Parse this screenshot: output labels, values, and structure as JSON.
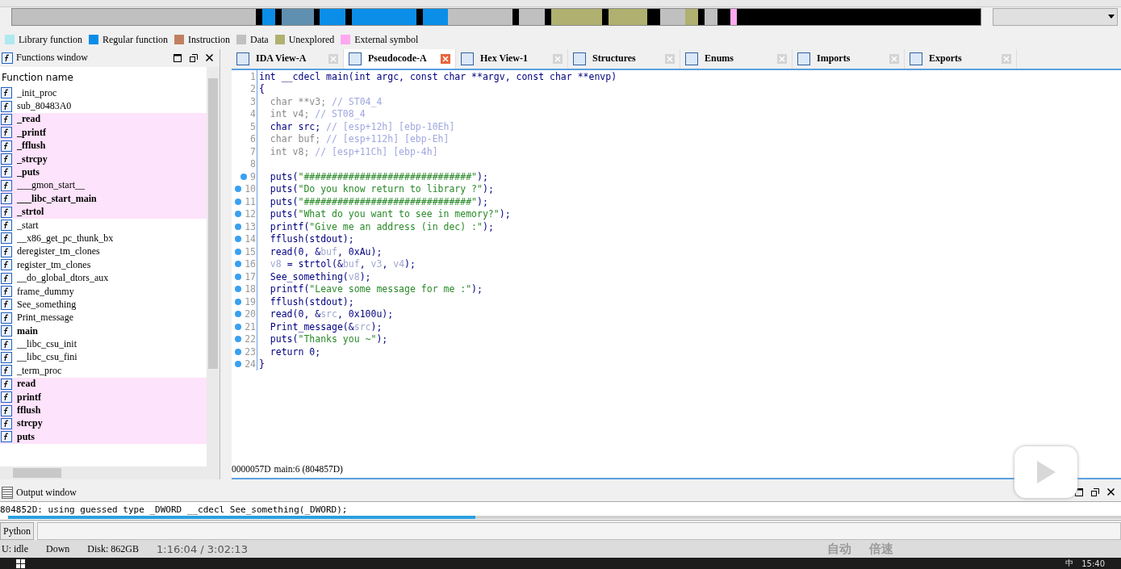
{
  "legend": [
    {
      "label": "Library function",
      "color": "#aee9f0"
    },
    {
      "label": "Regular function",
      "color": "#0a8ee8"
    },
    {
      "label": "Instruction",
      "color": "#c08060"
    },
    {
      "label": "Data",
      "color": "#c0c0c0"
    },
    {
      "label": "Unexplored",
      "color": "#b0b070"
    },
    {
      "label": "External symbol",
      "color": "#ffa8f0"
    }
  ],
  "functions_window": {
    "title": "Functions window",
    "column": "Function name",
    "items": [
      {
        "name": "_init_proc",
        "external": false,
        "bold": false
      },
      {
        "name": "sub_80483A0",
        "external": false,
        "bold": false
      },
      {
        "name": "_read",
        "external": true,
        "bold": true
      },
      {
        "name": "_printf",
        "external": true,
        "bold": true
      },
      {
        "name": "_fflush",
        "external": true,
        "bold": true
      },
      {
        "name": "_strcpy",
        "external": true,
        "bold": true
      },
      {
        "name": "_puts",
        "external": true,
        "bold": true
      },
      {
        "name": "___gmon_start__",
        "external": true,
        "bold": false
      },
      {
        "name": "___libc_start_main",
        "external": true,
        "bold": true
      },
      {
        "name": "_strtol",
        "external": true,
        "bold": true
      },
      {
        "name": "_start",
        "external": false,
        "bold": false
      },
      {
        "name": "__x86_get_pc_thunk_bx",
        "external": false,
        "bold": false
      },
      {
        "name": "deregister_tm_clones",
        "external": false,
        "bold": false
      },
      {
        "name": "register_tm_clones",
        "external": false,
        "bold": false
      },
      {
        "name": "__do_global_dtors_aux",
        "external": false,
        "bold": false
      },
      {
        "name": "frame_dummy",
        "external": false,
        "bold": false
      },
      {
        "name": "See_something",
        "external": false,
        "bold": false
      },
      {
        "name": "Print_message",
        "external": false,
        "bold": false
      },
      {
        "name": "main",
        "external": false,
        "bold": true
      },
      {
        "name": "__libc_csu_init",
        "external": false,
        "bold": false
      },
      {
        "name": "__libc_csu_fini",
        "external": false,
        "bold": false
      },
      {
        "name": "_term_proc",
        "external": false,
        "bold": false
      },
      {
        "name": "read",
        "external": true,
        "bold": true
      },
      {
        "name": "printf",
        "external": true,
        "bold": true
      },
      {
        "name": "fflush",
        "external": true,
        "bold": true
      },
      {
        "name": "strcpy",
        "external": true,
        "bold": true
      },
      {
        "name": "puts",
        "external": true,
        "bold": true
      }
    ]
  },
  "tabs": [
    {
      "label": "IDA View-A",
      "selected": false
    },
    {
      "label": "Pseudocode-A",
      "selected": true
    },
    {
      "label": "Hex View-1",
      "selected": false
    },
    {
      "label": "Structures",
      "selected": false
    },
    {
      "label": "Enums",
      "selected": false
    },
    {
      "label": "Imports",
      "selected": false
    },
    {
      "label": "Exports",
      "selected": false
    }
  ],
  "code_lines": [
    {
      "number": "1",
      "breakpoint": false,
      "segments": [
        {
          "kind": "code",
          "text": "int __cdecl main(int argc, const char **argv, const char **envp)"
        }
      ]
    },
    {
      "number": "2",
      "breakpoint": false,
      "segments": [
        {
          "kind": "code",
          "text": "{"
        }
      ]
    },
    {
      "number": "3",
      "breakpoint": false,
      "segments": [
        {
          "kind": "dim",
          "text": "  char **v3; "
        },
        {
          "kind": "comment",
          "text": "// ST04_4"
        }
      ]
    },
    {
      "number": "4",
      "breakpoint": false,
      "segments": [
        {
          "kind": "dim",
          "text": "  int v4; "
        },
        {
          "kind": "comment",
          "text": "// ST08_4"
        }
      ]
    },
    {
      "number": "5",
      "breakpoint": false,
      "segments": [
        {
          "kind": "code",
          "text": "  char src; "
        },
        {
          "kind": "comment",
          "text": "// [esp+12h] [ebp-10Eh]"
        }
      ]
    },
    {
      "number": "6",
      "breakpoint": false,
      "segments": [
        {
          "kind": "dim",
          "text": "  char buf; "
        },
        {
          "kind": "comment",
          "text": "// [esp+112h] [ebp-Eh]"
        }
      ]
    },
    {
      "number": "7",
      "breakpoint": false,
      "segments": [
        {
          "kind": "dim",
          "text": "  int v8; "
        },
        {
          "kind": "comment",
          "text": "// [esp+11Ch] [ebp-4h]"
        }
      ]
    },
    {
      "number": "8",
      "breakpoint": false
    },
    {
      "number": "9",
      "breakpoint": true,
      "segments": [
        {
          "kind": "code",
          "text": "  puts("
        },
        {
          "kind": "string",
          "text": "\"##############################\""
        },
        {
          "kind": "code",
          "text": ");"
        }
      ]
    },
    {
      "number": "10",
      "breakpoint": true,
      "segments": [
        {
          "kind": "code",
          "text": "  puts("
        },
        {
          "kind": "string",
          "text": "\"Do you know return to library ?\""
        },
        {
          "kind": "code",
          "text": ");"
        }
      ]
    },
    {
      "number": "11",
      "breakpoint": true,
      "segments": [
        {
          "kind": "code",
          "text": "  puts("
        },
        {
          "kind": "string",
          "text": "\"##############################\""
        },
        {
          "kind": "code",
          "text": ");"
        }
      ]
    },
    {
      "number": "12",
      "breakpoint": true,
      "segments": [
        {
          "kind": "code",
          "text": "  puts("
        },
        {
          "kind": "string",
          "text": "\"What do you want to see in memory?\""
        },
        {
          "kind": "code",
          "text": ");"
        }
      ]
    },
    {
      "number": "13",
      "breakpoint": true,
      "segments": [
        {
          "kind": "code",
          "text": "  printf("
        },
        {
          "kind": "string",
          "text": "\"Give me an address (in dec) :\""
        },
        {
          "kind": "code",
          "text": ");"
        }
      ]
    },
    {
      "number": "14",
      "breakpoint": true,
      "segments": [
        {
          "kind": "code",
          "text": "  fflush(stdout);"
        }
      ]
    },
    {
      "number": "15",
      "breakpoint": true,
      "segments": [
        {
          "kind": "code",
          "text": "  read(0, &"
        },
        {
          "kind": "var",
          "text": "buf"
        },
        {
          "kind": "code",
          "text": ", 0xAu);"
        }
      ]
    },
    {
      "number": "16",
      "breakpoint": true,
      "segments": [
        {
          "kind": "var",
          "text": "  v8"
        },
        {
          "kind": "code",
          "text": " = strtol(&"
        },
        {
          "kind": "var",
          "text": "buf"
        },
        {
          "kind": "code",
          "text": ", "
        },
        {
          "kind": "var",
          "text": "v3"
        },
        {
          "kind": "code",
          "text": ", "
        },
        {
          "kind": "var",
          "text": "v4"
        },
        {
          "kind": "code",
          "text": ");"
        }
      ]
    },
    {
      "number": "17",
      "breakpoint": true,
      "segments": [
        {
          "kind": "code",
          "text": "  See_something("
        },
        {
          "kind": "var",
          "text": "v8"
        },
        {
          "kind": "code",
          "text": ");"
        }
      ]
    },
    {
      "number": "18",
      "breakpoint": true,
      "segments": [
        {
          "kind": "code",
          "text": "  printf("
        },
        {
          "kind": "string",
          "text": "\"Leave some message for me :\""
        },
        {
          "kind": "code",
          "text": ");"
        }
      ]
    },
    {
      "number": "19",
      "breakpoint": true,
      "segments": [
        {
          "kind": "code",
          "text": "  fflush(stdout);"
        }
      ]
    },
    {
      "number": "20",
      "breakpoint": true,
      "segments": [
        {
          "kind": "code",
          "text": "  read(0, &"
        },
        {
          "kind": "var",
          "text": "src"
        },
        {
          "kind": "code",
          "text": ", 0x100u);"
        }
      ]
    },
    {
      "number": "21",
      "breakpoint": true,
      "segments": [
        {
          "kind": "code",
          "text": "  Print_message(&"
        },
        {
          "kind": "var",
          "text": "src"
        },
        {
          "kind": "code",
          "text": ");"
        }
      ]
    },
    {
      "number": "22",
      "breakpoint": true,
      "segments": [
        {
          "kind": "code",
          "text": "  puts("
        },
        {
          "kind": "string",
          "text": "\"Thanks you ~\""
        },
        {
          "kind": "code",
          "text": ");"
        }
      ]
    },
    {
      "number": "23",
      "breakpoint": true,
      "segments": [
        {
          "kind": "code",
          "text": "  return 0;"
        }
      ]
    },
    {
      "number": "24",
      "breakpoint": true,
      "segments": [
        {
          "kind": "code",
          "text": "}"
        }
      ]
    }
  ],
  "code_status": {
    "address": "0000057D",
    "location": "main:6 (804857D)"
  },
  "output_window": {
    "title": "Output window",
    "message": "804852D: using guessed type _DWORD __cdecl See_something(_DWORD);",
    "progress": {
      "level": 0.42
    }
  },
  "python_button": "Python",
  "status_bar": {
    "state": "U:  idle",
    "direction": "Down",
    "disk": "Disk: 862GB"
  },
  "video_player": {
    "time": "1:16:04 / 3:02:13",
    "quality": "自动",
    "speed": "倍速"
  },
  "taskbar": {
    "ime": "中",
    "clock": "15:40"
  }
}
